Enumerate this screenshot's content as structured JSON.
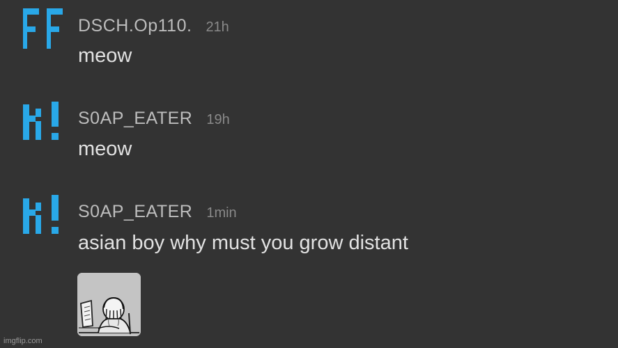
{
  "colors": {
    "background": "#333333",
    "avatar_blue": "#29a8e8",
    "username": "#bdbdbd",
    "timestamp": "#8a8a8a",
    "message_text": "#e2e2e2"
  },
  "messages": [
    {
      "avatar_icon": "ff-pixel-avatar-icon",
      "username": "DSCH.Op110.",
      "timestamp": "21h",
      "text": "meow"
    },
    {
      "avatar_icon": "k-exclaim-pixel-avatar-icon",
      "username": "S0AP_EATER",
      "timestamp": "19h",
      "text": "meow"
    },
    {
      "avatar_icon": "k-exclaim-pixel-avatar-icon",
      "username": "S0AP_EATER",
      "timestamp": "1min",
      "text": "asian boy why must you grow distant",
      "attachment_icon": "crying-at-computer-sticker-icon"
    }
  ],
  "watermark": "imgflip.com"
}
